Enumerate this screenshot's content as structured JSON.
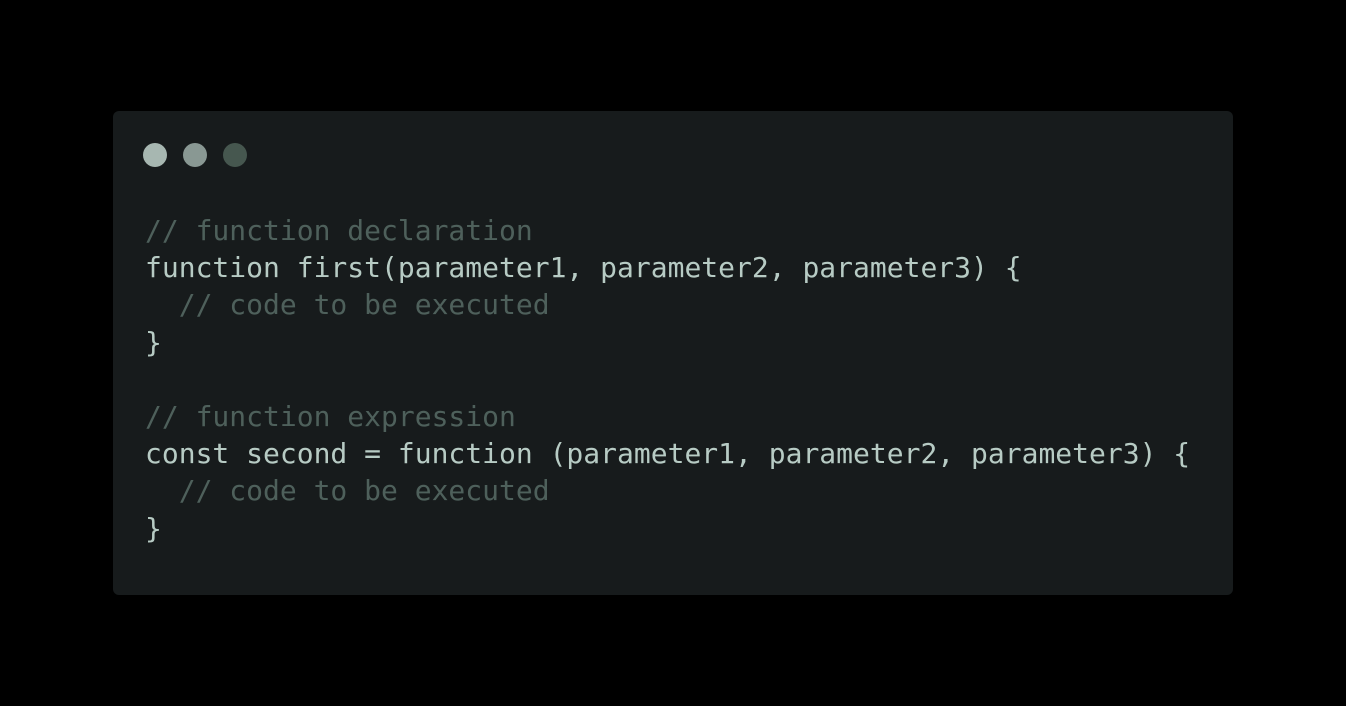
{
  "window": {
    "controls": [
      {
        "name": "close",
        "color": "#a7b7b1"
      },
      {
        "name": "minimize",
        "color": "#899893"
      },
      {
        "name": "maximize",
        "color": "#46574f"
      }
    ],
    "background": "#171b1c"
  },
  "colors": {
    "code_text": "#b7cbc4",
    "comment_text": "#4e605b",
    "page_background": "#000000"
  },
  "code": {
    "lines": [
      {
        "kind": "comment",
        "text": "// function declaration"
      },
      {
        "kind": "code",
        "text": "function first(parameter1, parameter2, parameter3) {"
      },
      {
        "kind": "comment",
        "text": "  // code to be executed"
      },
      {
        "kind": "code",
        "text": "}"
      },
      {
        "kind": "blank",
        "text": ""
      },
      {
        "kind": "comment",
        "text": "// function expression"
      },
      {
        "kind": "code",
        "text": "const second = function (parameter1, parameter2, parameter3) {"
      },
      {
        "kind": "comment",
        "text": "  // code to be executed"
      },
      {
        "kind": "code",
        "text": "}"
      }
    ]
  }
}
